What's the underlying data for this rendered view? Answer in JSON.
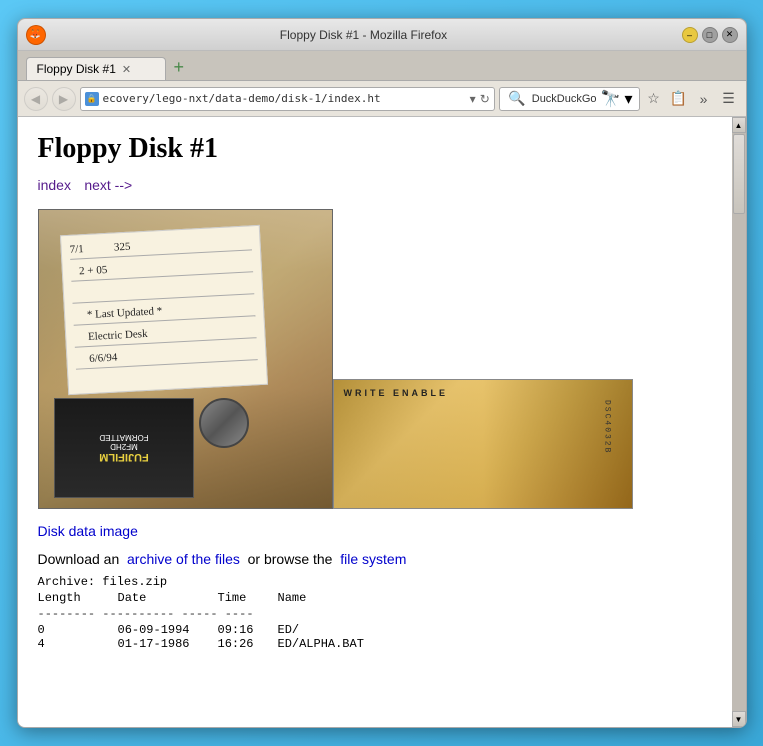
{
  "browser": {
    "title": "Floppy Disk #1 - Mozilla Firefox",
    "tab_label": "Floppy Disk #1",
    "url": "ecovery/lego-nxt/data-demo/disk-1/index.ht",
    "search_placeholder": "DuckDuckGo"
  },
  "page": {
    "heading": "Floppy Disk #1",
    "nav_links": {
      "index": "index",
      "next": "next -->"
    },
    "disk_data_link": "Disk data image",
    "download_text": "Download an",
    "archive_link": "archive of the files",
    "or_text": "or browse the",
    "filesystem_link": "file system",
    "archive_header": "Archive:  files.zip",
    "archive_columns": [
      "Length",
      "Date",
      "Time",
      "Name"
    ],
    "archive_separator": "--------  ----------  -----  ----",
    "archive_rows": [
      {
        "length": "0",
        "date": "06-09-1994",
        "time": "09:16",
        "name": "ED/"
      },
      {
        "length": "4",
        "date": "01-17-1986",
        "time": "16:26",
        "name": "ED/ALPHA.BAT"
      }
    ]
  },
  "disk_label": {
    "line1": "7/1",
    "line2": "2 + 05",
    "line3": "325",
    "line4": "Last Updated*",
    "line5": "Electric Desk",
    "line6": "6/6/94"
  },
  "disk_bottom": {
    "brand": "FUJIFILM",
    "type": "MF2HD",
    "label": "FORMATTED"
  }
}
